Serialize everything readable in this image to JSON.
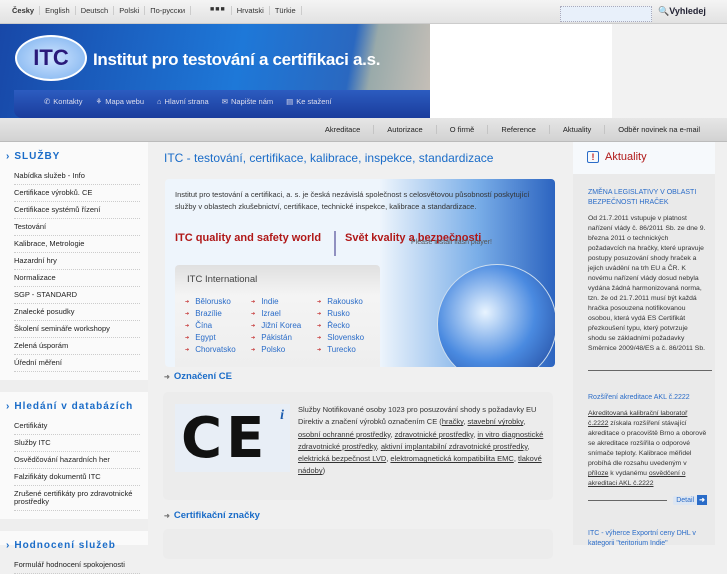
{
  "top": {
    "languages": [
      "Česky",
      "English",
      "Deutsch",
      "Polski",
      "По-русски",
      "Hrvatski",
      "Türkie"
    ],
    "flags": "■■■",
    "search_button": "Vyhledej",
    "search_value": ""
  },
  "header": {
    "logo": "ITC",
    "title": "Institut pro testování a certifikaci a.s.",
    "links": [
      "Kontakty",
      "Mapa webu",
      "Hlavní strana",
      "Napište nám",
      "Ke stažení"
    ]
  },
  "nav": [
    "Akreditace",
    "Autorizace",
    "O firmě",
    "Reference",
    "Aktuality",
    "Odběr novinek na e-mail"
  ],
  "sidebar": {
    "sluzby": {
      "title": "SLUŽBY",
      "items": [
        "Nabídka služeb - Info",
        "Certifikace výrobků. CE",
        "Certifikace systémů řízení",
        "Testování",
        "Kalibrace, Metrologie",
        "Hazardní hry",
        "Normalizace",
        "SGP - STANDARD",
        "Znalecké posudky",
        "Školení semináře workshopy",
        "Zelená úsporám",
        "Úřední měření"
      ]
    },
    "hledani": {
      "title": "Hledání v databázích",
      "items": [
        "Certifikáty",
        "Služby ITC",
        "Osvědčování hazardních her",
        "Falzifikáty dokumentů ITC",
        "Zrušené certifikáty pro zdravotnické prostředky"
      ]
    },
    "hodnoceni": {
      "title": "Hodnocení služeb",
      "items": [
        "Formulář hodnocení spokojenosti"
      ]
    }
  },
  "main": {
    "title": "ITC - testování, certifikace, kalibrace, inspekce, standardizace",
    "intro": "Institut pro testování a certifikaci, a. s. je česká nezávislá společnost s celosvětovou působností poskytující služby v oblastech zkušebnictví, certifikace, technické inspekce, kalibrace a standardizace.",
    "slogan_en": "ITC quality and safety world",
    "slogan_cz": "Svět kvality a bezpečnosti",
    "flash_msg": "Please install flash player!",
    "intl_title": "ITC International",
    "countries": [
      "Bělorusko",
      "Indie",
      "Rakousko",
      "Brazílie",
      "Izrael",
      "Rusko",
      "Čína",
      "Jižní Korea",
      "Řecko",
      "Egypt",
      "Pákistán",
      "Slovensko",
      "Chorvatsko",
      "Polsko",
      "Turecko"
    ],
    "ce_heading": "Označení CE",
    "ce_logo": "CE",
    "ce_text_pre": "Služby Notifikované osoby 1023 pro posuzování shody s požadavky EU Direktiv a značení výrobků označením CE (",
    "ce_links": [
      "hračky",
      "stavební výrobky",
      "osobní ochranné prostředky",
      "zdravotnické prostředky",
      "in vitro diagnostické zdravotnické prostředky",
      "aktivní implantabilní zdravotnické prostředky",
      "elektrická bezpečnost LVD",
      "elektromagnetická kompatibilita EMC",
      "tlakové nádoby"
    ],
    "ce_text_post": ")",
    "cert_heading": "Certifikační značky"
  },
  "aktuality": {
    "title": "Aktuality",
    "news": [
      {
        "title": "ZMĚNA LEGISLATIVY V OBLASTI BEZPEČNOSTI HRAČEK",
        "body": "Od 21.7.2011 vstupuje v platnost nařízení vlády č. 86/2011 Sb. ze dne 9. března 2011 o technických požadavcích na hračky, které upravuje postupy posuzování shody hraček a jejich uvádění na trh EU a ČR. K novému nařízení vlády dosud nebyla vydána žádná harmonizovaná norma, tzn. že od 21.7.2011 musí být každá hračka posouzena notifikovanou osobou, která vydá ES Certifikát přezkoušení typu, který potvrzuje shodu se základními požadavky Směrnice 2009/48/ES a č. 86/2011 Sb."
      },
      {
        "title": "Rozšíření akreditace AKL č.2222",
        "link1": "Akreditovaná kalibrační laboratoř č.2222",
        "body1": " získala rozšíření stávající akreditace o pracoviště Brno a oborově se akreditace rozšířila o odporové snímače teploty. Kalibrace měřidel probíhá dle rozsahu uvedeným v ",
        "link2": "příloze",
        "body2": " k vydanému ",
        "link3": "osvědčení o akreditaci AKL č.2222",
        "detail": "Detail"
      },
      {
        "title": "ITC - výherce Exportní ceny DHL v kategorii \"teritorium Indie\""
      }
    ]
  }
}
